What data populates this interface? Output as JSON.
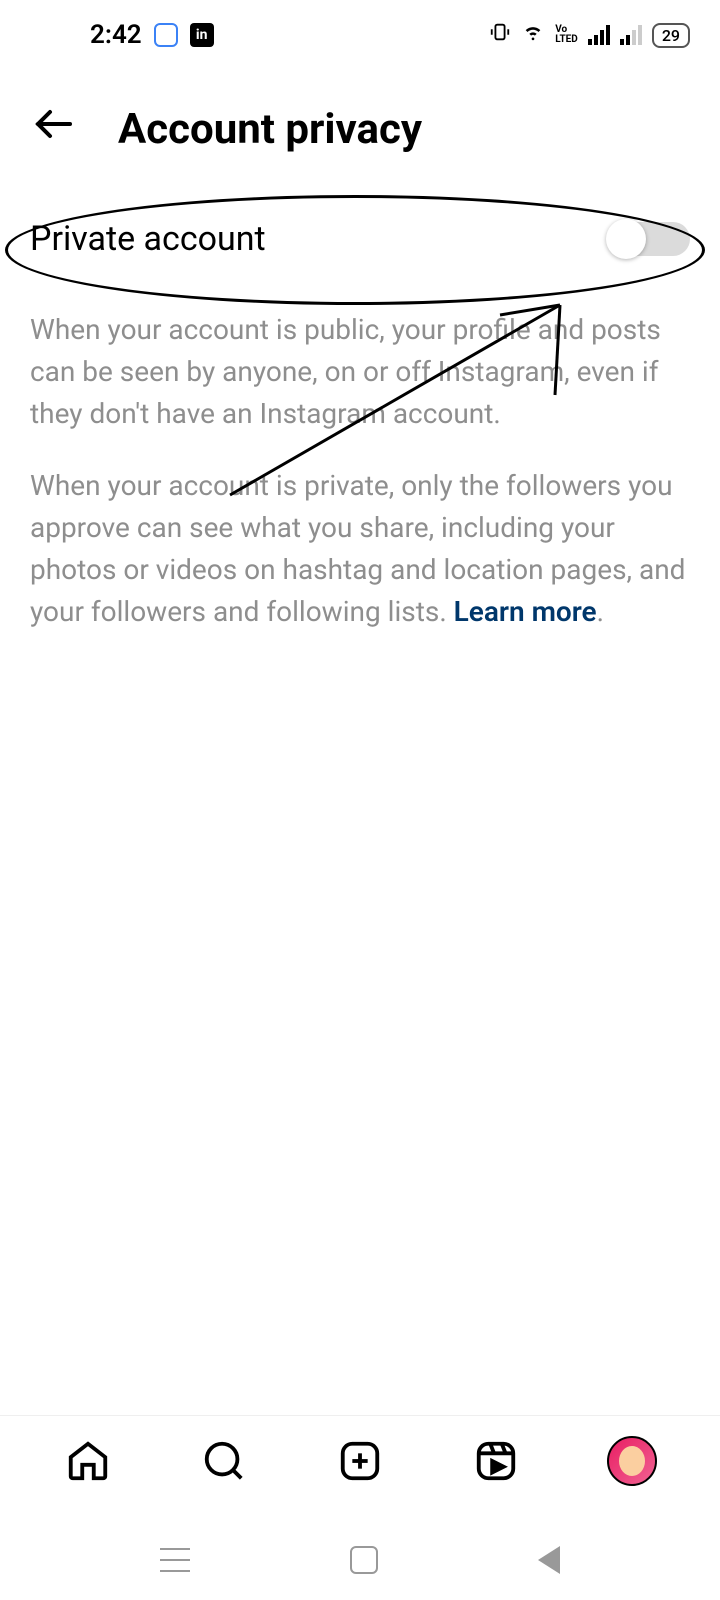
{
  "status_bar": {
    "time": "2:42",
    "battery": "29",
    "vo": "Vo",
    "lted": "LTED"
  },
  "header": {
    "title": "Account privacy"
  },
  "main": {
    "private_account_label": "Private account",
    "description_p1": "When your account is public, your profile and posts can be seen by anyone, on or off Instagram, even if they don't have an Instagram account.",
    "description_p2": "When your account is private, only the followers you approve can see what you share, including your photos or videos on hashtag and location pages, and your followers and following lists. ",
    "learn_more": "Learn more",
    "period": "."
  },
  "icons": {
    "linkedin": "in"
  }
}
